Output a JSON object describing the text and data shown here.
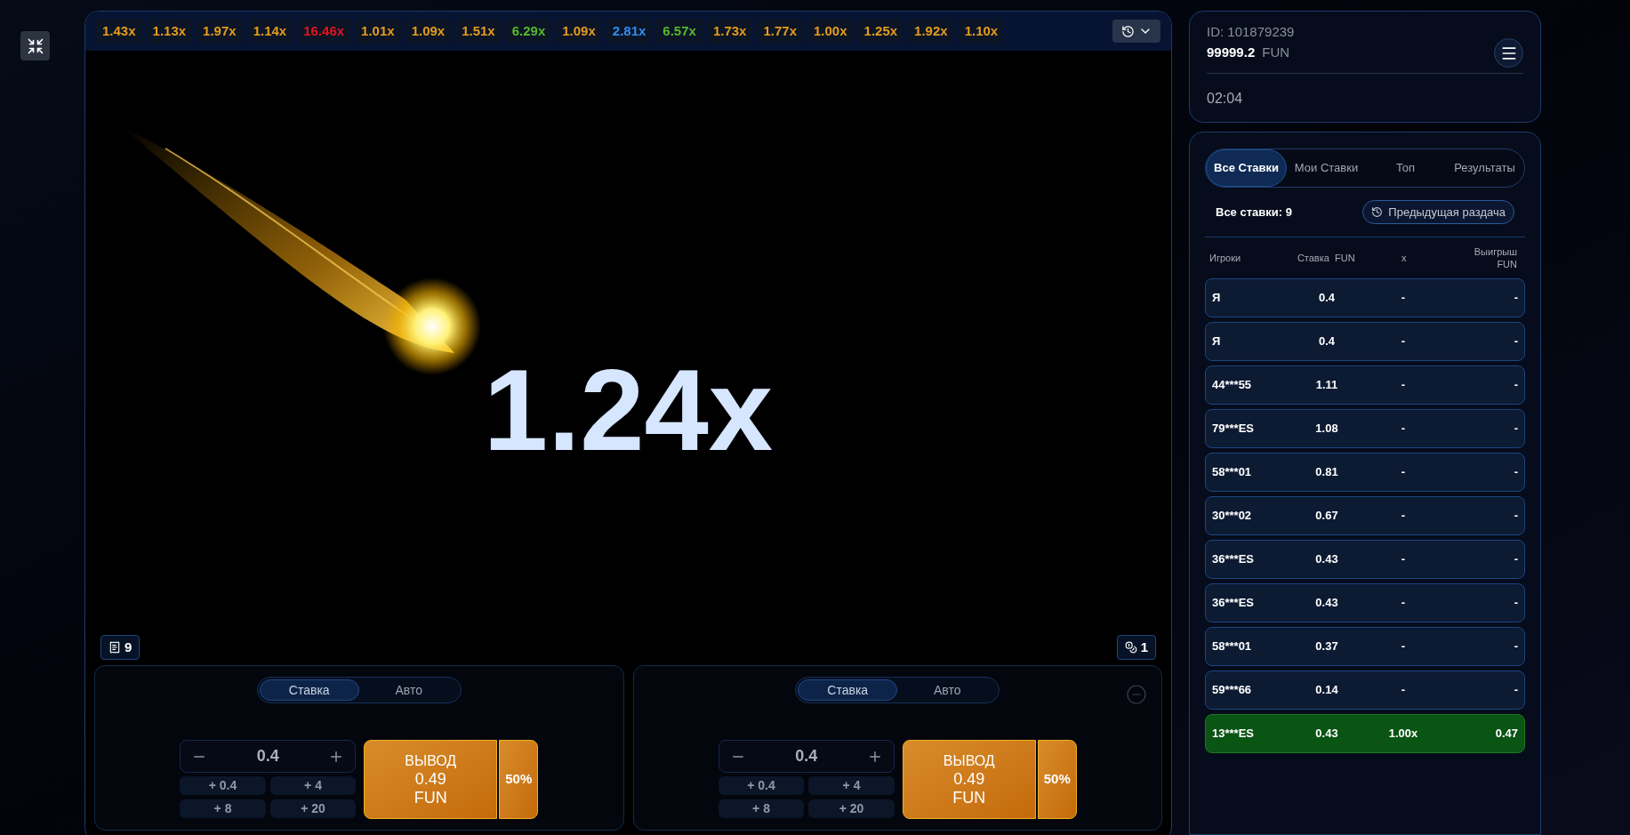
{
  "history": [
    {
      "value": "1.43x",
      "color": "#e59b1c"
    },
    {
      "value": "1.13x",
      "color": "#e59b1c"
    },
    {
      "value": "1.97x",
      "color": "#e59b1c"
    },
    {
      "value": "1.14x",
      "color": "#e59b1c"
    },
    {
      "value": "16.46x",
      "color": "#e5141c"
    },
    {
      "value": "1.01x",
      "color": "#e59b1c"
    },
    {
      "value": "1.09x",
      "color": "#e59b1c"
    },
    {
      "value": "1.51x",
      "color": "#e59b1c"
    },
    {
      "value": "6.29x",
      "color": "#58b82a"
    },
    {
      "value": "1.09x",
      "color": "#e59b1c"
    },
    {
      "value": "2.81x",
      "color": "#2f8ef0"
    },
    {
      "value": "6.57x",
      "color": "#58b82a"
    },
    {
      "value": "1.73x",
      "color": "#e59b1c"
    },
    {
      "value": "1.77x",
      "color": "#e59b1c"
    },
    {
      "value": "1.00x",
      "color": "#e59b1c"
    },
    {
      "value": "1.25x",
      "color": "#e59b1c"
    },
    {
      "value": "1.92x",
      "color": "#e59b1c"
    },
    {
      "value": "1.10x",
      "color": "#e59b1c"
    }
  ],
  "game": {
    "multiplier": "1.24x",
    "bet_count": "9",
    "cashout_count": "1"
  },
  "bet_panels": [
    {
      "tabs": [
        {
          "label": "Ставка",
          "selected": true
        },
        {
          "label": "Авто",
          "selected": false
        }
      ],
      "amount": "0.4",
      "quick": [
        "+ 0.4",
        "+ 4",
        "+ 8",
        "+ 20"
      ],
      "cashout": {
        "label": "ВЫВОД",
        "amount": "0.49",
        "currency": "FUN"
      },
      "percent": "50%",
      "removable": false
    },
    {
      "tabs": [
        {
          "label": "Ставка",
          "selected": true
        },
        {
          "label": "Авто",
          "selected": false
        }
      ],
      "amount": "0.4",
      "quick": [
        "+ 0.4",
        "+ 4",
        "+ 8",
        "+ 20"
      ],
      "cashout": {
        "label": "ВЫВОД",
        "amount": "0.49",
        "currency": "FUN"
      },
      "percent": "50%",
      "removable": true
    }
  ],
  "account": {
    "id": "ID: 101879239",
    "balance": "99999.2",
    "currency": "FUN",
    "time": "02:04"
  },
  "bets": {
    "tabs": [
      {
        "label": "Все Ставки",
        "selected": true
      },
      {
        "label": "Мои Ставки",
        "selected": false
      },
      {
        "label": "Топ",
        "selected": false
      },
      {
        "label": "Результаты",
        "selected": false
      }
    ],
    "total": "Все ставки: 9",
    "previous_button": "Предыдущая раздача",
    "columns": [
      "Игроки",
      "Ставка  FUN",
      "x",
      "Выигрыш FUN"
    ],
    "rows": [
      {
        "player": "Я",
        "bet": "0.4",
        "x": "-",
        "win": "-",
        "won": false
      },
      {
        "player": "Я",
        "bet": "0.4",
        "x": "-",
        "win": "-",
        "won": false
      },
      {
        "player": "44***55",
        "bet": "1.11",
        "x": "-",
        "win": "-",
        "won": false
      },
      {
        "player": "79***ES",
        "bet": "1.08",
        "x": "-",
        "win": "-",
        "won": false
      },
      {
        "player": "58***01",
        "bet": "0.81",
        "x": "-",
        "win": "-",
        "won": false
      },
      {
        "player": "30***02",
        "bet": "0.67",
        "x": "-",
        "win": "-",
        "won": false
      },
      {
        "player": "36***ES",
        "bet": "0.43",
        "x": "-",
        "win": "-",
        "won": false
      },
      {
        "player": "36***ES",
        "bet": "0.43",
        "x": "-",
        "win": "-",
        "won": false
      },
      {
        "player": "58***01",
        "bet": "0.37",
        "x": "-",
        "win": "-",
        "won": false
      },
      {
        "player": "59***66",
        "bet": "0.14",
        "x": "-",
        "win": "-",
        "won": false
      },
      {
        "player": "13***ES",
        "bet": "0.43",
        "x": "1.00x",
        "win": "0.47",
        "won": true
      }
    ]
  }
}
